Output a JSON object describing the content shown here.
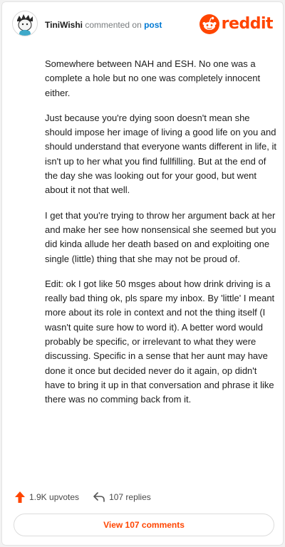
{
  "header": {
    "username": "TiniWishi",
    "verb": "commented on",
    "post_link": "post",
    "logo_text": "reddit"
  },
  "comment": {
    "paragraphs": [
      "Somewhere between NAH and ESH. No one was a complete a hole but no one was completely innocent either.",
      "Just because you're dying soon doesn't mean she should impose her image of living a good life on you and should understand that everyone wants different in life, it isn't up to her what you find fullfilling. But at the end of the day she was looking out for your good, but went about it not that well.",
      "I get that you're trying to throw her argument back at her and make her see how nonsensical she seemed but you did kinda allude her death based on and exploiting one single (little) thing that she may not be proud of.",
      "Edit: ok I got like 50 msges about how drink driving is a really bad thing ok, pls spare my inbox. By 'little' I meant more about its role in context and not the thing itself (I wasn't quite sure how to word it). A better word would probably be specific, or irrelevant to what they were discussing. Specific in a sense that her aunt may have done it once but decided never do it again, op didn't have to bring it up in that conversation and phrase it like there was no comming back from it."
    ]
  },
  "actions": {
    "upvotes": "1.9K upvotes",
    "replies": "107 replies"
  },
  "view_comments": "View 107 comments",
  "colors": {
    "brand": "#ff4500",
    "link": "#0079d3",
    "text": "#1c1c1c",
    "muted": "#787c7e"
  },
  "icons": [
    "avatar",
    "reddit-snoo-icon",
    "upvote-arrow-icon",
    "reply-arrow-icon"
  ]
}
